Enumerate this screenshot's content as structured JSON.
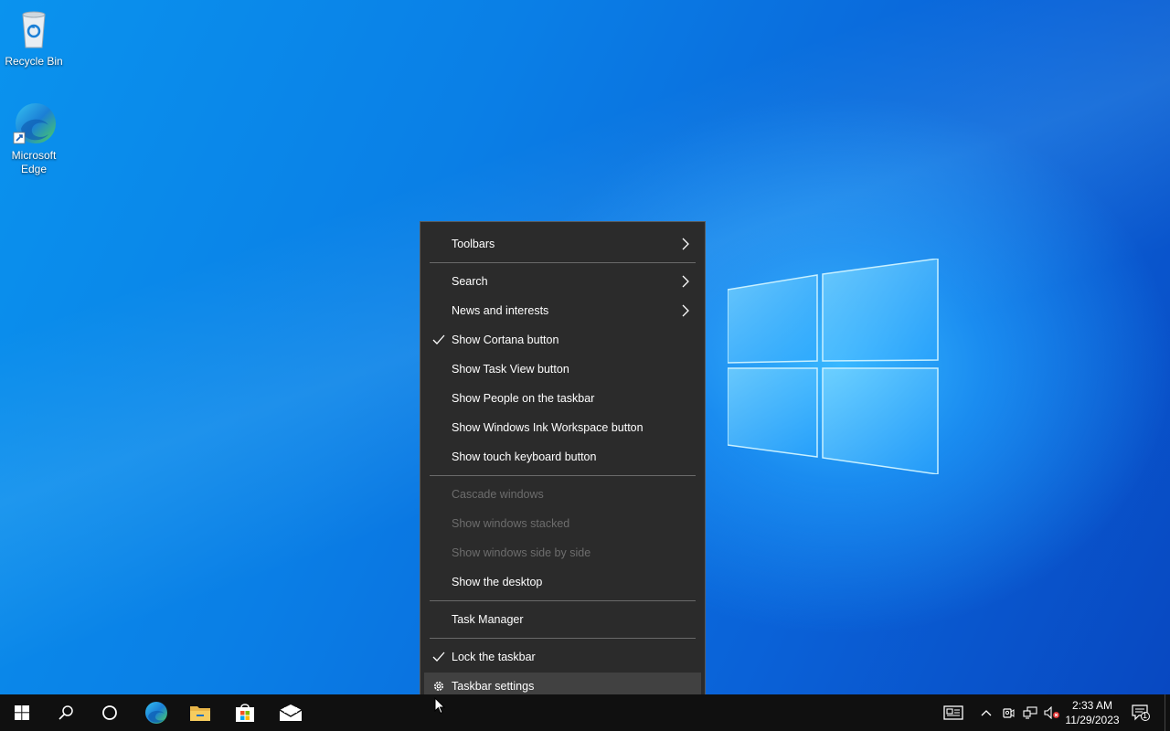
{
  "desktop": {
    "icons": [
      {
        "label": "Recycle Bin",
        "icon": "recycle-bin-icon"
      },
      {
        "label": "Microsoft Edge",
        "icon": "edge-icon"
      }
    ]
  },
  "context_menu": {
    "items": [
      {
        "label": "Toolbars",
        "submenu": true
      },
      {
        "label": "Search",
        "submenu": true
      },
      {
        "label": "News and interests",
        "submenu": true
      },
      {
        "label": "Show Cortana button",
        "checked": true
      },
      {
        "label": "Show Task View button"
      },
      {
        "label": "Show People on the taskbar"
      },
      {
        "label": "Show Windows Ink Workspace button"
      },
      {
        "label": "Show touch keyboard button"
      },
      {
        "label": "Cascade windows",
        "disabled": true
      },
      {
        "label": "Show windows stacked",
        "disabled": true
      },
      {
        "label": "Show windows side by side",
        "disabled": true
      },
      {
        "label": "Show the desktop"
      },
      {
        "label": "Task Manager"
      },
      {
        "label": "Lock the taskbar",
        "checked": true
      },
      {
        "label": "Taskbar settings",
        "icon": "gear-icon",
        "hovered": true
      }
    ]
  },
  "taskbar": {
    "pinned": [
      "start-icon",
      "search-icon",
      "cortana-icon",
      "edge-icon",
      "file-explorer-icon",
      "store-icon",
      "mail-icon"
    ],
    "tray": [
      "news-icon",
      "chevron-up-icon",
      "meet-now-icon",
      "network-icon",
      "volume-muted-icon"
    ],
    "clock": {
      "time": "2:33 AM",
      "date": "11/29/2023"
    },
    "notifications_count": "1"
  },
  "colors": {
    "accent": "#0a78e0",
    "menu_bg": "#2b2b2b",
    "taskbar_bg": "#101010"
  }
}
